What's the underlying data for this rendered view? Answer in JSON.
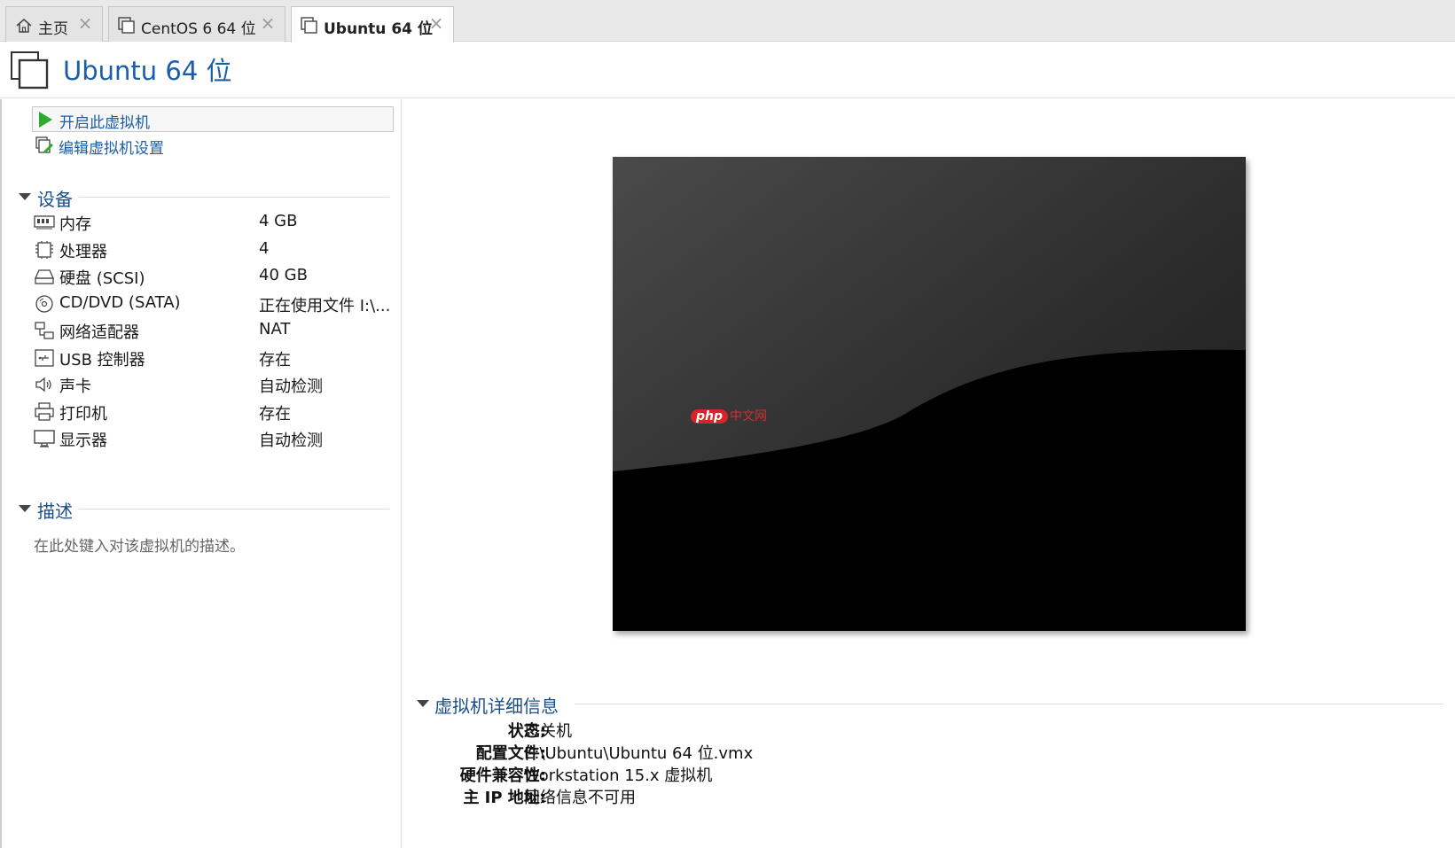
{
  "tabs": [
    {
      "label": "主页",
      "icon": "home-icon",
      "active": false
    },
    {
      "label": "CentOS 6 64 位",
      "icon": "vm-icon",
      "active": false
    },
    {
      "label": "Ubuntu 64 位",
      "icon": "vm-icon",
      "active": true
    }
  ],
  "header": {
    "title": "Ubuntu 64 位"
  },
  "actions": {
    "power_on": "开启此虚拟机",
    "edit_settings": "编辑虚拟机设置"
  },
  "devices": {
    "title": "设备",
    "items": [
      {
        "name": "内存",
        "value": "4 GB",
        "icon": "memory-icon"
      },
      {
        "name": "处理器",
        "value": "4",
        "icon": "cpu-icon"
      },
      {
        "name": "硬盘 (SCSI)",
        "value": "40 GB",
        "icon": "hard-disk-icon"
      },
      {
        "name": "CD/DVD (SATA)",
        "value": "正在使用文件 I:\\...",
        "icon": "cd-dvd-icon"
      },
      {
        "name": "网络适配器",
        "value": "NAT",
        "icon": "network-icon"
      },
      {
        "name": "USB 控制器",
        "value": "存在",
        "icon": "usb-icon"
      },
      {
        "name": "声卡",
        "value": "自动检测",
        "icon": "speaker-icon"
      },
      {
        "name": "打印机",
        "value": "存在",
        "icon": "printer-icon"
      },
      {
        "name": "显示器",
        "value": "自动检测",
        "icon": "monitor-icon"
      }
    ]
  },
  "description": {
    "title": "描述",
    "placeholder": "在此处键入对该虚拟机的描述。"
  },
  "watermark": {
    "badge": "php",
    "text": "中文网"
  },
  "details": {
    "title": "虚拟机详细信息",
    "rows": [
      {
        "label": "状态:",
        "value": "已关机"
      },
      {
        "label": "配置文件:",
        "value": "E:\\Ubuntu\\Ubuntu 64 位.vmx"
      },
      {
        "label": "硬件兼容性:",
        "value": "Workstation 15.x 虚拟机"
      },
      {
        "label": "主 IP 地址:",
        "value": "网络信息不可用"
      }
    ]
  },
  "colors": {
    "accent_blue": "#1a5ea8",
    "section_blue": "#1a4f8a",
    "play_green": "#2eaa2e"
  }
}
